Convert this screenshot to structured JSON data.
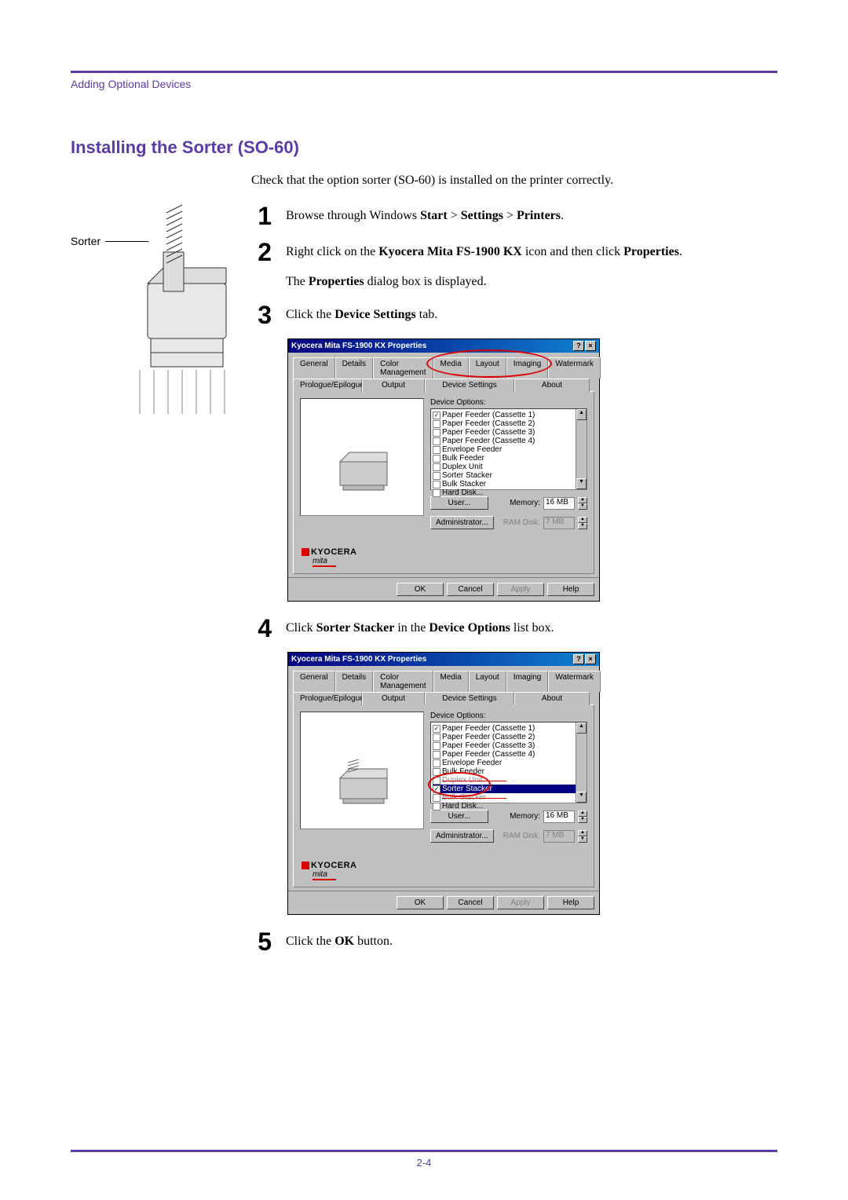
{
  "header": {
    "label": "Adding Optional Devices"
  },
  "section": {
    "title": "Installing the Sorter (SO-60)"
  },
  "sorter": {
    "label": "Sorter"
  },
  "intro": "Check that the option sorter (SO-60) is installed on the printer correctly.",
  "steps": {
    "s1": {
      "pre": "Browse through Windows ",
      "b1": "Start",
      "sep": " > ",
      "b2": "Settings",
      "b3": "Printers",
      "post": "."
    },
    "s2": {
      "pre": "Right click on the ",
      "b1": "Kyocera Mita FS-1900 KX",
      "mid": " icon and then click ",
      "b2": "Properties",
      "post": ".",
      "sub_pre": "The ",
      "sub_b": "Properties",
      "sub_post": " dialog box is displayed."
    },
    "s3": {
      "pre": "Click the ",
      "b1": "Device Settings",
      "post": " tab."
    },
    "s4": {
      "pre": "Click ",
      "b1": "Sorter Stacker",
      "mid": " in the ",
      "b2": "Device Options",
      "post": " list box."
    },
    "s5": {
      "pre": "Click the ",
      "b1": "OK",
      "post": " button."
    }
  },
  "dialog": {
    "title": "Kyocera Mita FS-1900 KX Properties",
    "help_btn": "?",
    "close_btn": "×",
    "tabs_row1": [
      "General",
      "Details",
      "Color Management",
      "Media",
      "Layout",
      "Imaging",
      "Watermark"
    ],
    "tabs_row2": [
      "Prologue/Epilogue",
      "Output",
      "Device Settings",
      "About"
    ],
    "options_label": "Device Options:",
    "options": [
      "Paper Feeder (Cassette 1)",
      "Paper Feeder (Cassette 2)",
      "Paper Feeder (Cassette 3)",
      "Paper Feeder (Cassette 4)",
      "Envelope Feeder",
      "Bulk Feeder",
      "Duplex Unit",
      "Sorter Stacker",
      "Bulk Stacker",
      "Hard Disk..."
    ],
    "user_btn": "User...",
    "admin_btn": "Administrator...",
    "memory_label": "Memory:",
    "ramdisk_label": "RAM Disk:",
    "memory_value": "16 MB",
    "ramdisk_value": "7 MB",
    "logo1": "KYOCERA",
    "logo2": "mita",
    "footer": {
      "ok": "OK",
      "cancel": "Cancel",
      "apply": "Apply",
      "help": "Help"
    }
  },
  "footer": {
    "page": "2-4"
  }
}
